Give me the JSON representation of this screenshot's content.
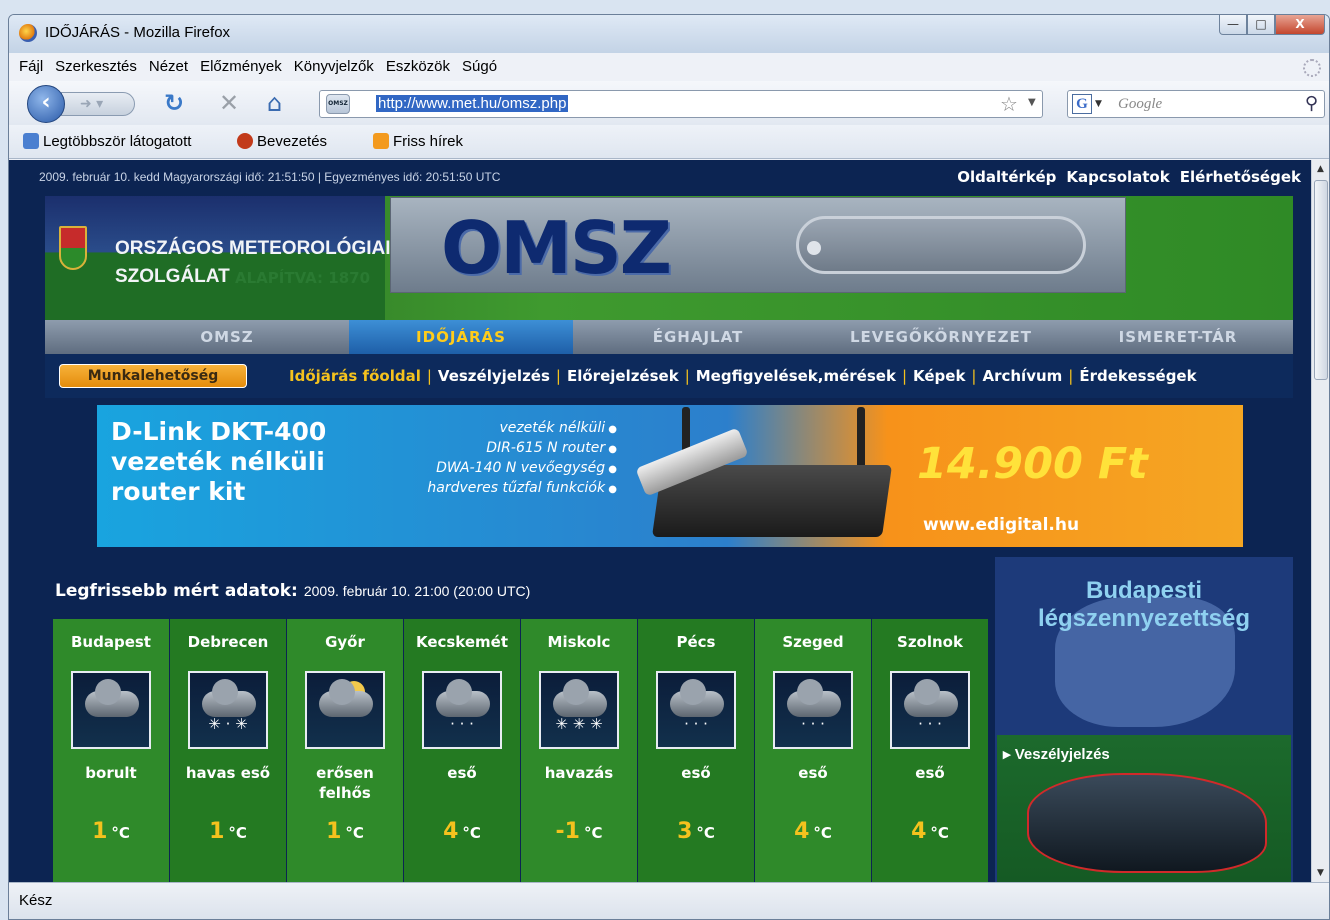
{
  "window": {
    "title": "IDŐJÁRÁS - Mozilla Firefox"
  },
  "menu": [
    "Fájl",
    "Szerkesztés",
    "Nézet",
    "Előzmények",
    "Könyvjelzők",
    "Eszközök",
    "Súgó"
  ],
  "nav": {
    "url": "http://www.met.hu/omsz.php",
    "search_placeholder": "Google",
    "site_icon": "OMSZ"
  },
  "bookmarks": [
    "Legtöbbször látogatott",
    "Bevezetés",
    "Friss hírek"
  ],
  "status": "Kész",
  "page": {
    "topinfo": "2009. február 10. kedd   Magyarországi idő: 21:51:50 | Egyezményes idő: 20:51:50 UTC",
    "toplinks": [
      "Oldaltérkép",
      "Kapcsolatok",
      "Elérhetőségek"
    ],
    "org_line1": "ORSZÁGOS METEOROLÓGIAI",
    "org_line2": "SZOLGÁLAT",
    "founded": "ALAPÍTVA: 1870",
    "logo_text": "OMSZ",
    "tabs": [
      {
        "label": "OMSZ",
        "active": false
      },
      {
        "label": "IDŐJÁRÁS",
        "active": true
      },
      {
        "label": "ÉGHAJLAT",
        "active": false
      },
      {
        "label": "LEVEGŐKÖRNYEZET",
        "active": false
      },
      {
        "label": "ISMERET-TÁR",
        "active": false
      }
    ],
    "munka_button": "Munkalehetőség",
    "sublinks": [
      "Időjárás főoldal",
      "Veszélyjelzés",
      "Előrejelzések",
      "Megfigyelések,mérések",
      "Képek",
      "Archívum",
      "Érdekességek"
    ],
    "ad": {
      "title": "D-Link DKT-400\nvezeték nélküli\nrouter kit",
      "features": [
        "vezeték nélküli",
        "DIR-615 N router",
        "DWA-140 N vevőegység",
        "hardveres tűzfal funkciók"
      ],
      "price": "14.900 Ft",
      "url": "www.edigital.hu"
    },
    "weather": {
      "heading": "Legfrissebb mért adatok:",
      "date": "2009. február 10. 21:00 (20:00 UTC)",
      "unit": "°C",
      "cities": [
        {
          "name": "Budapest",
          "desc": "borult",
          "temp": "1",
          "icon": "overcast-icon"
        },
        {
          "name": "Debrecen",
          "desc": "havas eső",
          "temp": "1",
          "icon": "sleet-icon"
        },
        {
          "name": "Győr",
          "desc": "erősen felhős",
          "temp": "1",
          "icon": "mostly-cloudy-icon"
        },
        {
          "name": "Kecskemét",
          "desc": "eső",
          "temp": "4",
          "icon": "rain-icon"
        },
        {
          "name": "Miskolc",
          "desc": "havazás",
          "temp": "-1",
          "icon": "snow-icon"
        },
        {
          "name": "Pécs",
          "desc": "eső",
          "temp": "3",
          "icon": "rain-icon"
        },
        {
          "name": "Szeged",
          "desc": "eső",
          "temp": "4",
          "icon": "rain-icon"
        },
        {
          "name": "Szolnok",
          "desc": "eső",
          "temp": "4",
          "icon": "rain-icon"
        }
      ]
    },
    "sidebar": {
      "air_title": "Budapesti légszennyezettség",
      "warning_title": "Veszélyjelzés"
    }
  }
}
